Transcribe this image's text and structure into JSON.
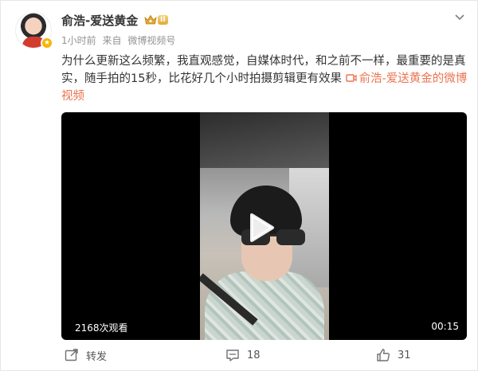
{
  "post": {
    "username": "俞浩-爱送黄金",
    "vip_level": "II",
    "time": "1小时前",
    "source_prefix": "来自",
    "source": "微博视频号",
    "text_main": "为什么更新这么频繁，我直观感觉，自媒体时代，和之前不一样，最重要的是真实，随手拍的15秒，比花好几个小时拍摄剪辑更有效果",
    "video_link": "俞浩-爱送黄金的微博视频",
    "icons": {
      "avatar": "user-avatar",
      "vip": "crown-icon",
      "menu": "chevron-down-icon",
      "video": "video-icon",
      "play": "play-icon",
      "repost": "repost-icon",
      "comment": "comment-icon",
      "like": "like-icon"
    }
  },
  "video": {
    "views": "2168次观看",
    "duration": "00:15"
  },
  "actions": {
    "repost": "转发",
    "comment": "18",
    "like": "31"
  },
  "colors": {
    "link": "#eb7350",
    "meta": "#939393",
    "text": "#333333"
  }
}
